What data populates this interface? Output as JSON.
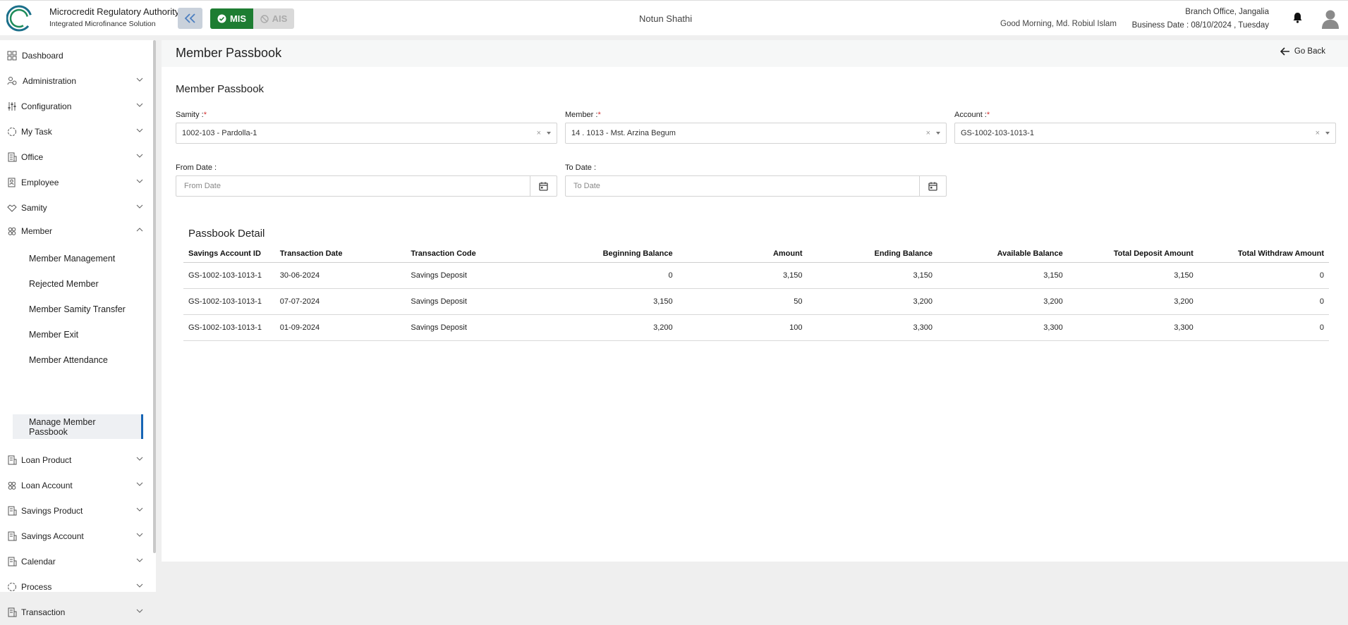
{
  "header": {
    "logo_text": "Microcredit Regulatory Authority",
    "logo_title": "Microcredit Regulatory Authority",
    "logo_subtitle": "Integrated Microfinance Solution",
    "mode_mis": "MIS",
    "mode_ais": "AIS",
    "app_name": "Notun Shathi",
    "greeting": "Good Morning, Md. Robiul Islam",
    "branch": "Branch Office, Jangalia",
    "business_date": "Business Date : 08/10/2024 , Tuesday"
  },
  "sidebar": {
    "items": [
      {
        "label": "Dashboard"
      },
      {
        "label": "Administration"
      },
      {
        "label": "Configuration"
      },
      {
        "label": "My Task"
      },
      {
        "label": "Office"
      },
      {
        "label": "Employee"
      },
      {
        "label": "Samity"
      },
      {
        "label": "Member"
      },
      {
        "label": "Loan Product"
      },
      {
        "label": "Loan Account"
      },
      {
        "label": "Savings Product"
      },
      {
        "label": "Savings Account"
      },
      {
        "label": "Calendar"
      },
      {
        "label": "Process"
      },
      {
        "label": "Transaction"
      }
    ],
    "member_sub": [
      {
        "label": "Member Management"
      },
      {
        "label": "Rejected Member"
      },
      {
        "label": "Member Samity Transfer"
      },
      {
        "label": "Member Exit"
      },
      {
        "label": "Member Attendance"
      },
      {
        "label": "Manage Member Passbook"
      }
    ]
  },
  "page": {
    "title": "Member Passbook",
    "go_back": "Go Back",
    "section_title": "Member Passbook",
    "form": {
      "samity_label": "Samity :",
      "samity_value": "1002-103 - Pardolla-1",
      "member_label": "Member :",
      "member_value": "14 . 1013 - Mst. Arzina Begum",
      "account_label": "Account :",
      "account_value": "GS-1002-103-1013-1",
      "required_mark": "*",
      "clear_glyph": "×",
      "from_date_label": "From Date :",
      "from_date_placeholder": "From Date",
      "to_date_label": "To Date :",
      "to_date_placeholder": "To Date"
    },
    "passbook": {
      "title": "Passbook Detail",
      "columns": [
        "Savings Account ID",
        "Transaction Date",
        "Transaction Code",
        "Beginning Balance",
        "Amount",
        "Ending Balance",
        "Available Balance",
        "Total Deposit Amount",
        "Total Withdraw Amount"
      ],
      "rows": [
        [
          "GS-1002-103-1013-1",
          "30-06-2024",
          "Savings Deposit",
          "0",
          "3,150",
          "3,150",
          "3,150",
          "3,150",
          "0"
        ],
        [
          "GS-1002-103-1013-1",
          "07-07-2024",
          "Savings Deposit",
          "3,150",
          "50",
          "3,200",
          "3,200",
          "3,200",
          "0"
        ],
        [
          "GS-1002-103-1013-1",
          "01-09-2024",
          "Savings Deposit",
          "3,200",
          "100",
          "3,300",
          "3,300",
          "3,300",
          "0"
        ]
      ]
    }
  },
  "colors": {
    "mis_green": "#1e7d32",
    "active_bar": "#1665b5",
    "required": "#d32f2f"
  }
}
